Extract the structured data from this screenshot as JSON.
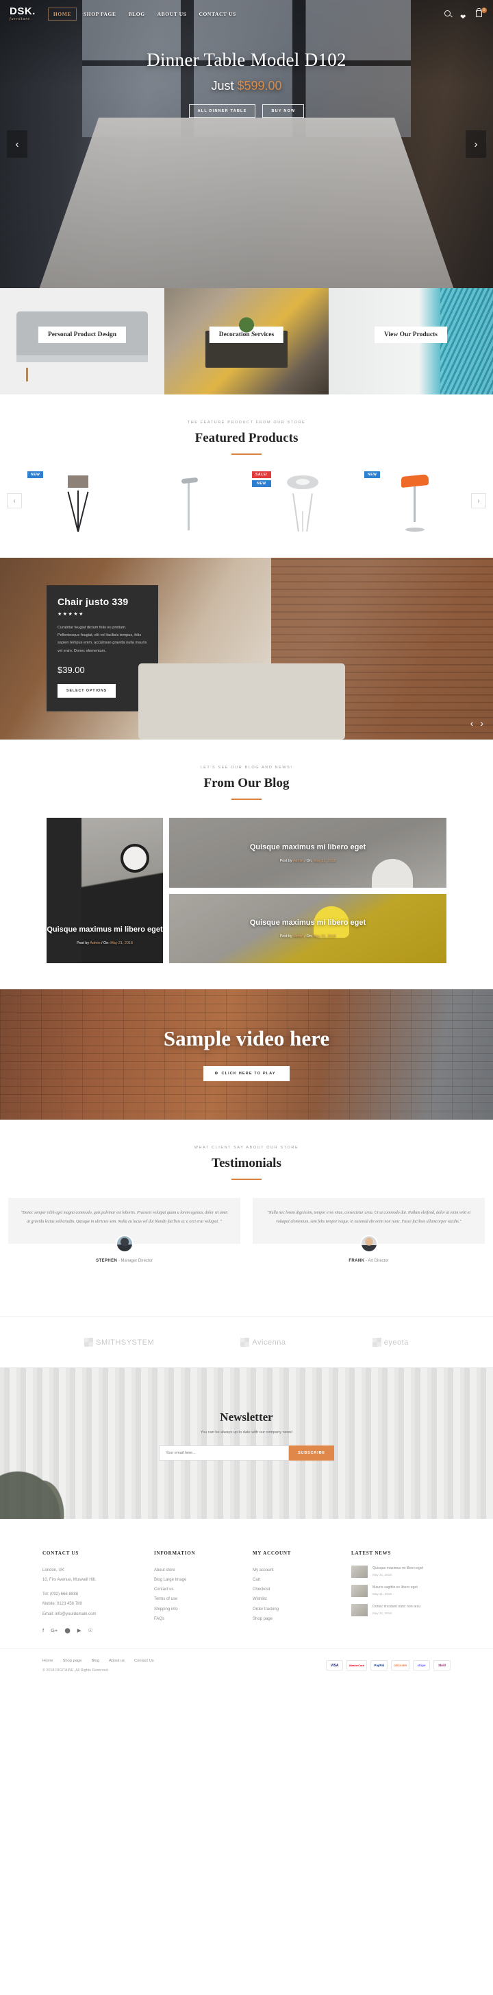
{
  "header": {
    "logo": "DSK.",
    "logo_sub": "furniture",
    "nav": [
      {
        "label": "HOME",
        "active": true
      },
      {
        "label": "SHOP PAGE",
        "active": false
      },
      {
        "label": "BLOG",
        "active": false
      },
      {
        "label": "ABOUT US",
        "active": false
      },
      {
        "label": "CONTACT US",
        "active": false
      }
    ],
    "icons": [
      "search-icon",
      "wishlist-heart-icon",
      "shopping-bag-icon"
    ],
    "cart_count": "0"
  },
  "hero": {
    "title": "Dinner Table Model D102",
    "price_prefix": "Just ",
    "price": "$599.00",
    "btn_primary": "ALL DINNER TABLE",
    "btn_secondary": "BUY NOW",
    "prev": "‹",
    "next": "›"
  },
  "services": [
    {
      "label": "Personal Product Design"
    },
    {
      "label": "Decoration Services"
    },
    {
      "label": "View Our Products"
    }
  ],
  "featured": {
    "eyebrow": "THE FEATURE PRODUCT FROM OUR STORE",
    "title": "Featured Products",
    "prev": "‹",
    "next": "›",
    "products": [
      {
        "name": "tripod-floor-lamp",
        "badges": [
          "NEW"
        ]
      },
      {
        "name": "shower-column",
        "badges": []
      },
      {
        "name": "white-bar-stool",
        "badges": [
          "SALE!",
          "NEW"
        ]
      },
      {
        "name": "orange-bar-stool",
        "badges": [
          "NEW"
        ]
      }
    ]
  },
  "promo": {
    "title": "Chair justo 339",
    "stars": "★★★★★",
    "desc": "Curabitur feugiat dictum felis eu pretium. Pellentesque feugiat, elit vel facilisis tempus, felis sapien tempus enim, accumsan gravida nulla mauris vel enim. Donec elementum.",
    "price": "$39.00",
    "button": "SELECT OPTIONS",
    "prev": "‹",
    "next": "›"
  },
  "blog": {
    "eyebrow": "LET'S SEE OUR BLOG AND NEWS!",
    "title": "From Our Blog",
    "posts": [
      {
        "title": "Quisque maximus mi libero eget",
        "meta_prefix": "Post by ",
        "author": "Admin",
        "meta_sep": " / On: ",
        "date": "May 21, 2018"
      },
      {
        "title": "Quisque maximus mi libero eget",
        "meta_prefix": "Post by ",
        "author": "Admin",
        "meta_sep": " / On: ",
        "date": "May 21, 2018"
      },
      {
        "title": "Quisque maximus mi libero eget",
        "meta_prefix": "Post by ",
        "author": "Admin",
        "meta_sep": " / On: ",
        "date": "May 21, 2018"
      }
    ]
  },
  "video": {
    "title": "Sample video here",
    "play_icon": "⚙",
    "play_label": "CLICK HERE TO PLAY"
  },
  "testimonials": {
    "eyebrow": "WHAT CLIENT SAY ABOUT OUR STORE",
    "title": "Testimonials",
    "items": [
      {
        "quote": "\"Donec semper nibh eget magna commodo, quis pulvinar est lobortis. Praesent volutpat quam a lorem egestas, dolor sit amet at gravida lectus sollicitudin. Quisque in ultricies sem. Nulla eu lacus vel dui blandit facilisis ac a orci erat volutpat. \"",
        "name": "STEPHEN",
        "role": " - Manager Director",
        "avatar": "avatar-stephen"
      },
      {
        "quote": "\"Nulla nec lorem dignissim, tempor eros vitae, consectetur urna. Ut ut commodo dui. Nullam eleifend, dolor at enim velit et volutpat elementum, sem felis tempor neque, in euismod elit enim non nunc. Fusce facilisis ullamcorper iaculis.\"",
        "name": "FRANK",
        "role": " - Art Director",
        "avatar": "avatar-frank"
      }
    ]
  },
  "brands": [
    {
      "name": "SMITHSYSTEM"
    },
    {
      "name": "Avicenna"
    },
    {
      "name": "eyeota"
    }
  ],
  "newsletter": {
    "title": "Newsletter",
    "subtitle": "You can be always up to date with our company news!",
    "input_placeholder": "Your email here...",
    "input_value": "",
    "button": "SUBSCRIBE"
  },
  "footer": {
    "contact": {
      "heading": "CONTACT US",
      "lines": [
        "London, UK",
        "10, Firs Avenue, Muswell Hill.",
        "",
        "Tel: (092) 666-8888",
        "Mobile: 0123 456 789",
        "Email: info@yourdomain.com"
      ],
      "socials": [
        "facebook-icon",
        "google-plus-icon",
        "twitter-icon",
        "youtube-icon",
        "pinterest-icon"
      ]
    },
    "information": {
      "heading": "INFORMATION",
      "links": [
        "About store",
        "Blog Large Image",
        "Contact us",
        "Terms of use",
        "Shipping info",
        "FAQs"
      ]
    },
    "account": {
      "heading": "MY ACCOUNT",
      "links": [
        "My account",
        "Cart",
        "Checkout",
        "Wishlist",
        "Order tracking",
        "Shop page"
      ]
    },
    "latest": {
      "heading": "LATEST NEWS",
      "items": [
        {
          "title": "Quisque maximus mi libero eget",
          "date": "May 21, 2018"
        },
        {
          "title": "Mauris sagittis ex libero eget",
          "date": "May 21, 2018"
        },
        {
          "title": "Donec tincidunt nunc non arcu",
          "date": "May 21, 2018"
        }
      ]
    },
    "bottom_nav": [
      "Home",
      "Shop page",
      "Blog",
      "About us",
      "Contact Us"
    ],
    "copyright": "© 2018 DIGITAINE. All Rights Reserved.",
    "payments": [
      "VISA",
      "MasterCard",
      "PayPal",
      "DISCOVER",
      "stripe",
      "Skrill"
    ]
  }
}
